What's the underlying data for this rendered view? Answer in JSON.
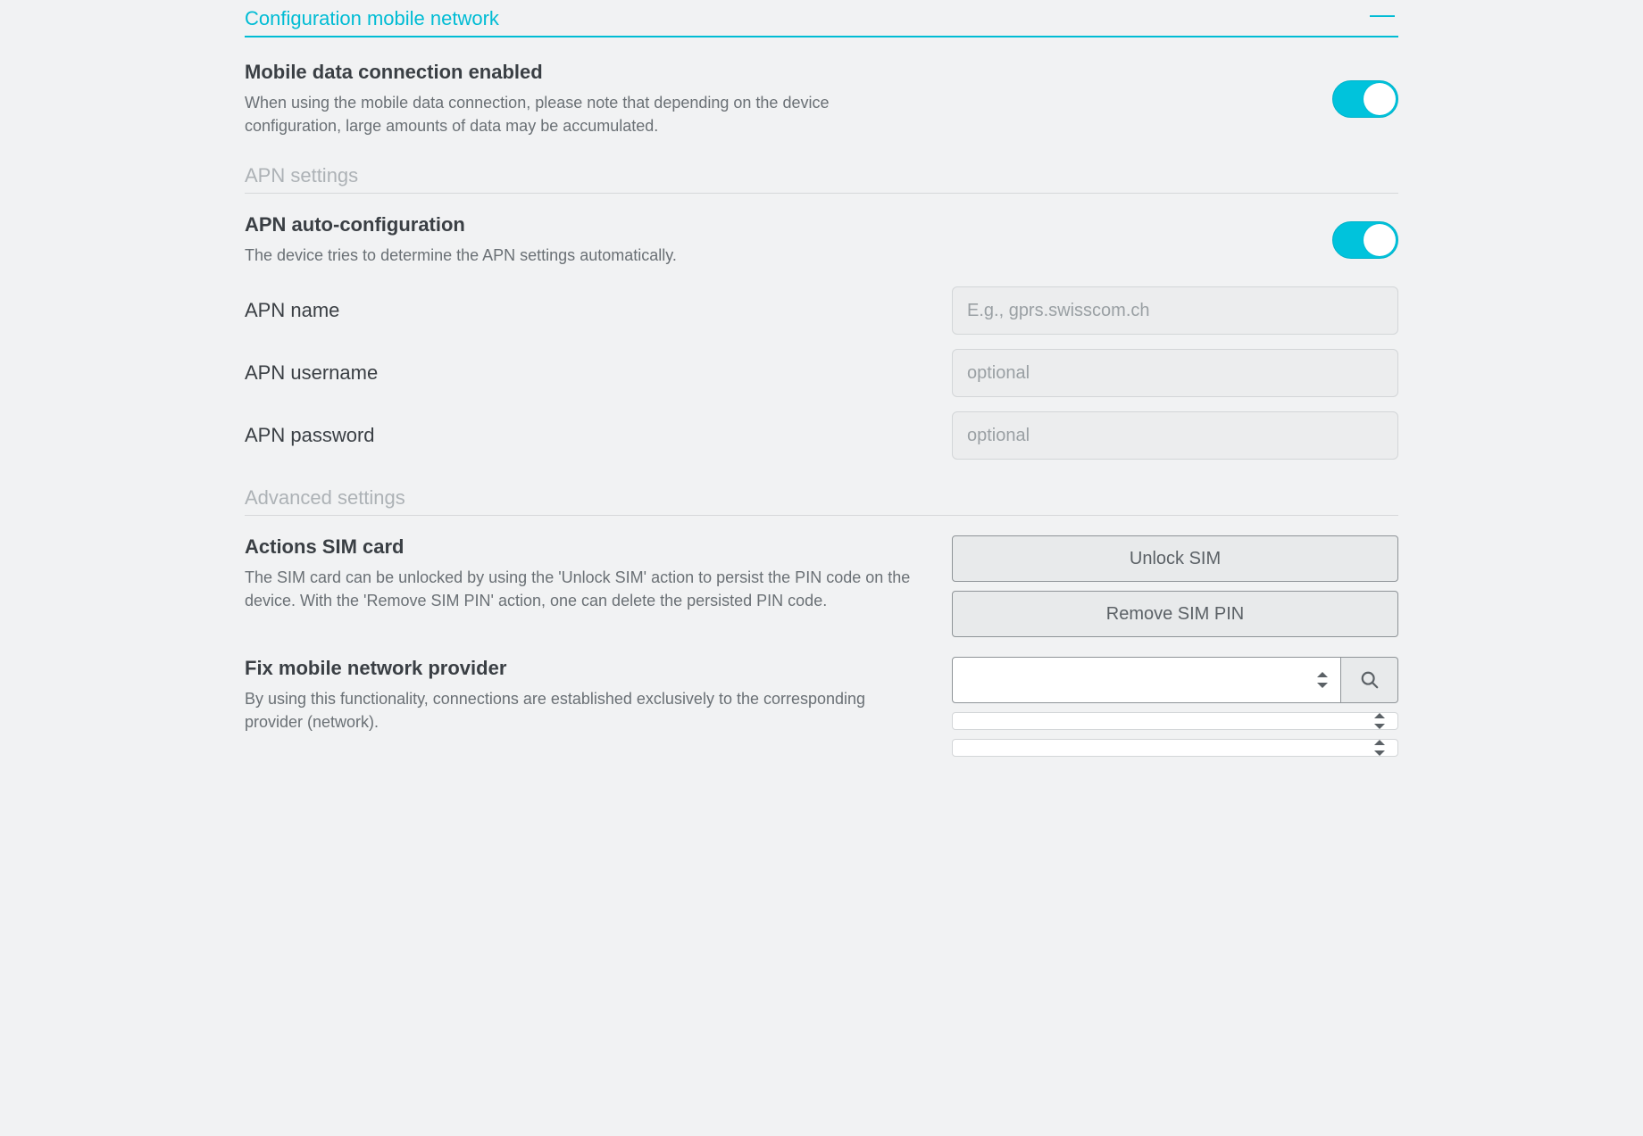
{
  "panel": {
    "title": "Configuration mobile network"
  },
  "mobile_data": {
    "title": "Mobile data connection enabled",
    "desc": "When using the mobile data connection, please note that depending on the device configuration, large amounts of data may be accumulated.",
    "enabled": true
  },
  "sections": {
    "apn": "APN settings",
    "advanced": "Advanced settings"
  },
  "apn_auto": {
    "title": "APN auto-configuration",
    "desc": "The device tries to determine the APN settings automatically.",
    "enabled": true
  },
  "apn_name": {
    "label": "APN name",
    "placeholder": "E.g., gprs.swisscom.ch",
    "value": ""
  },
  "apn_user": {
    "label": "APN username",
    "placeholder": "optional",
    "value": ""
  },
  "apn_pass": {
    "label": "APN password",
    "placeholder": "optional",
    "value": ""
  },
  "sim_actions": {
    "title": "Actions SIM card",
    "desc": "The SIM card can be unlocked by using the 'Unlock SIM' action to persist the PIN code on the device. With the 'Remove SIM PIN' action, one can delete the persisted PIN code.",
    "unlock_label": "Unlock SIM",
    "remove_label": "Remove SIM PIN"
  },
  "fix_provider": {
    "title": "Fix mobile network provider",
    "desc": "By using this functionality, connections are established exclusively to the corresponding provider (network)."
  }
}
